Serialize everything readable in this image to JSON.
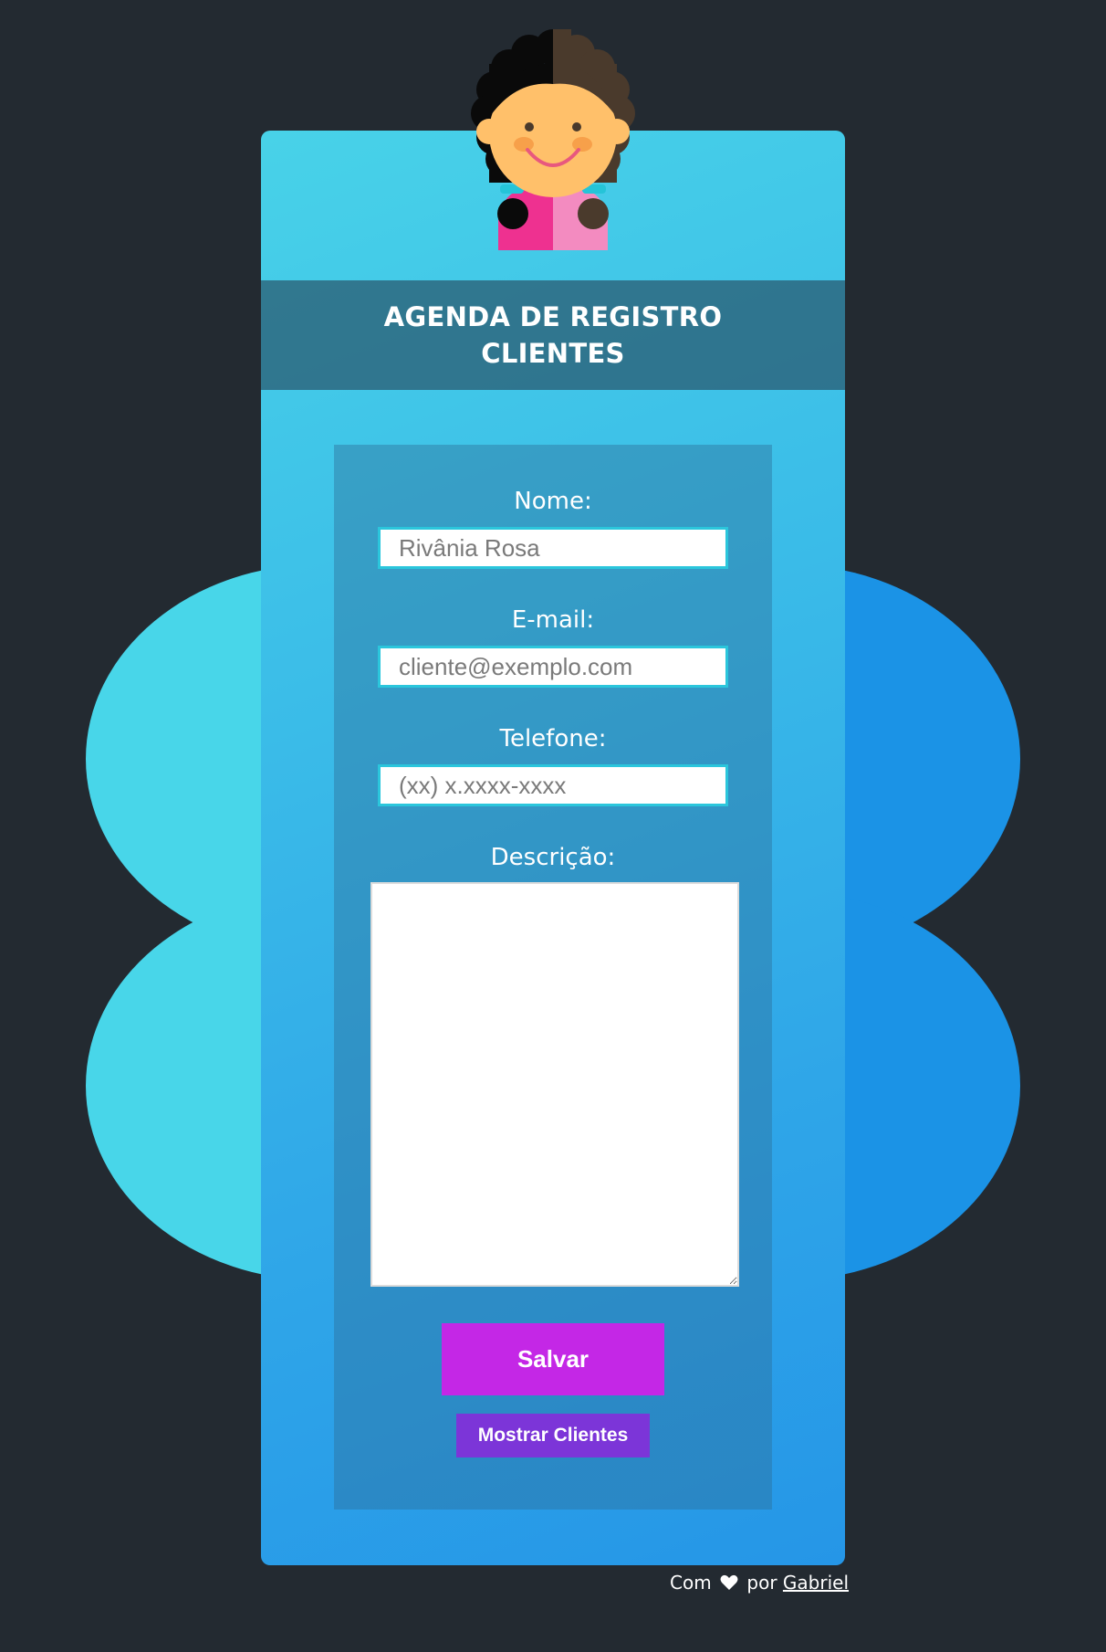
{
  "colors": {
    "page_background": "#232a31",
    "blob_left": "#48d6e9",
    "blob_right": "#1b93e6",
    "banner": "#2f6e84",
    "input_border": "#2bc6dc",
    "save_button": "#c427e6",
    "show_button": "#7c35d8"
  },
  "header": {
    "title": "AGENDA DE REGISTRO CLIENTES",
    "avatar_icon": "girl-avatar-icon"
  },
  "form": {
    "name": {
      "label": "Nome:",
      "value": "",
      "placeholder": "Rivânia Rosa"
    },
    "email": {
      "label": "E-mail:",
      "value": "",
      "placeholder": "cliente@exemplo.com"
    },
    "phone": {
      "label": "Telefone:",
      "value": "",
      "placeholder": "(xx) x.xxxx-xxxx"
    },
    "description": {
      "label": "Descrição:",
      "value": ""
    },
    "save_label": "Salvar",
    "show_clients_label": "Mostrar Clientes"
  },
  "footer": {
    "prefix": "Com",
    "heart_icon": "heart-icon",
    "middle": "por",
    "author_link": "Gabriel"
  }
}
